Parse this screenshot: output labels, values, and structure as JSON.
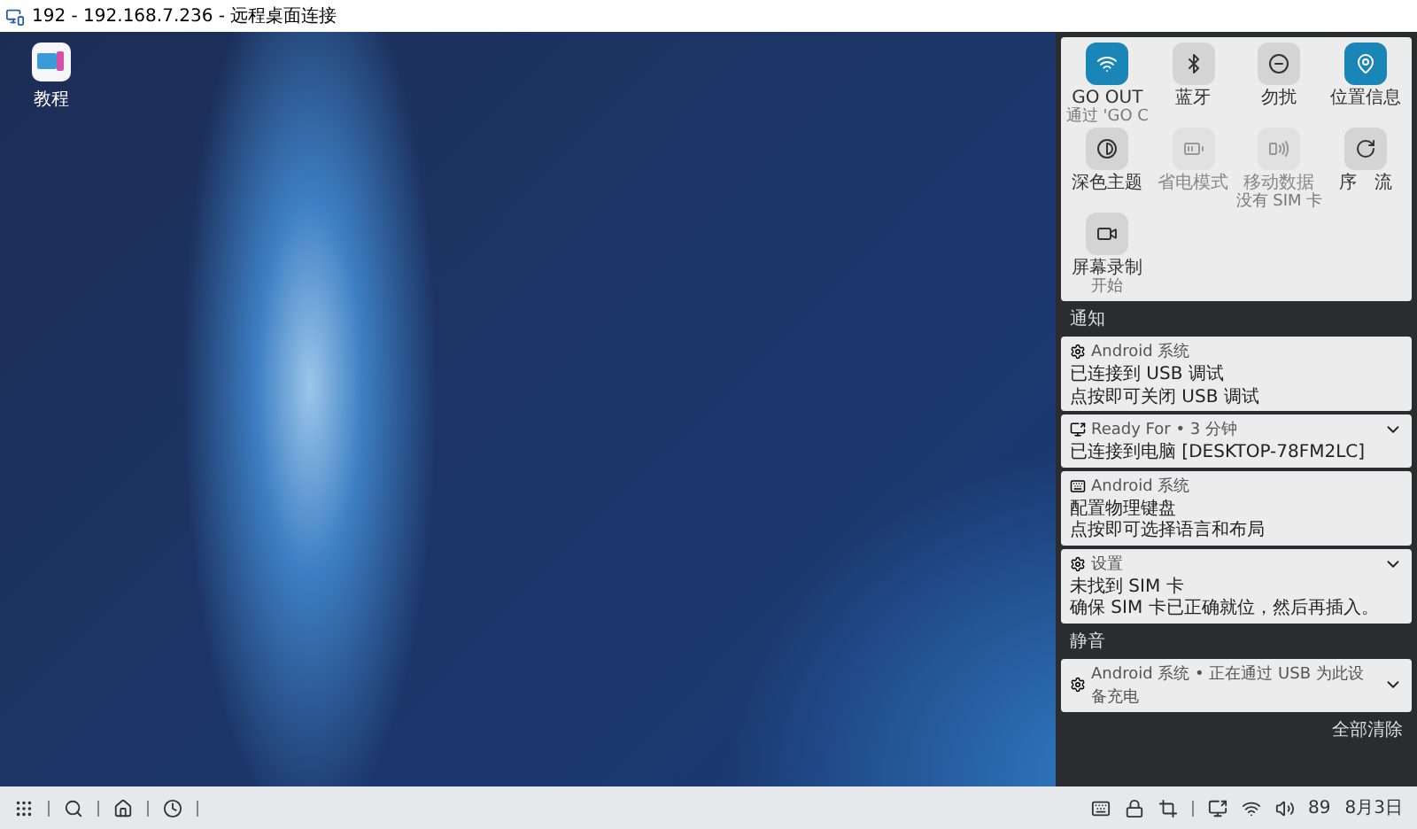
{
  "window": {
    "title": "192 - 192.168.7.236 - 远程桌面连接"
  },
  "desktop": {
    "icons": [
      {
        "label": "教程"
      }
    ]
  },
  "quick_settings": {
    "tiles": [
      {
        "kind": "wifi",
        "label": "GO OUT",
        "sublabel": "通过 'GO C",
        "on": true,
        "disabled": false
      },
      {
        "kind": "bluetooth",
        "label": "蓝牙",
        "on": false,
        "disabled": false
      },
      {
        "kind": "dnd",
        "label": "勿扰",
        "on": false,
        "disabled": false
      },
      {
        "kind": "location",
        "label": "位置信息",
        "on": true,
        "disabled": false
      },
      {
        "kind": "dark",
        "label": "深色主题",
        "on": false,
        "disabled": false
      },
      {
        "kind": "battery",
        "label": "省电模式",
        "on": false,
        "disabled": true
      },
      {
        "kind": "data",
        "label": "移动数据",
        "sublabel": "没有 SIM 卡",
        "on": false,
        "disabled": true
      },
      {
        "kind": "rotate",
        "label": "序　流",
        "on": false,
        "disabled": false
      },
      {
        "kind": "record",
        "label": "屏幕录制",
        "sublabel": "开始",
        "on": false,
        "disabled": false
      }
    ]
  },
  "notifications": {
    "header": "通知",
    "items": [
      {
        "kind": "android",
        "app": "Android 系统",
        "lines": [
          "已连接到 USB 调试",
          "点按即可关闭 USB 调试"
        ],
        "expandable": false
      },
      {
        "kind": "cast",
        "app": "Ready For • 3 分钟",
        "lines": [
          "已连接到电脑 [DESKTOP-78FM2LC]"
        ],
        "expandable": true
      },
      {
        "kind": "keyboard",
        "app": "Android 系统",
        "lines": [
          "配置物理键盘",
          "点按即可选择语言和布局"
        ],
        "expandable": false
      },
      {
        "kind": "settings",
        "app": "设置",
        "lines": [
          "未找到 SIM 卡",
          "确保 SIM 卡已正确就位，然后再插入。"
        ],
        "expandable": true
      }
    ]
  },
  "silent": {
    "header": "静音",
    "items": [
      {
        "kind": "android",
        "app": "Android 系统 • 正在通过 USB 为此设备充电",
        "expandable": true
      }
    ],
    "clear_all": "全部清除"
  },
  "taskbar": {
    "battery": "89",
    "date": "8月3日"
  }
}
